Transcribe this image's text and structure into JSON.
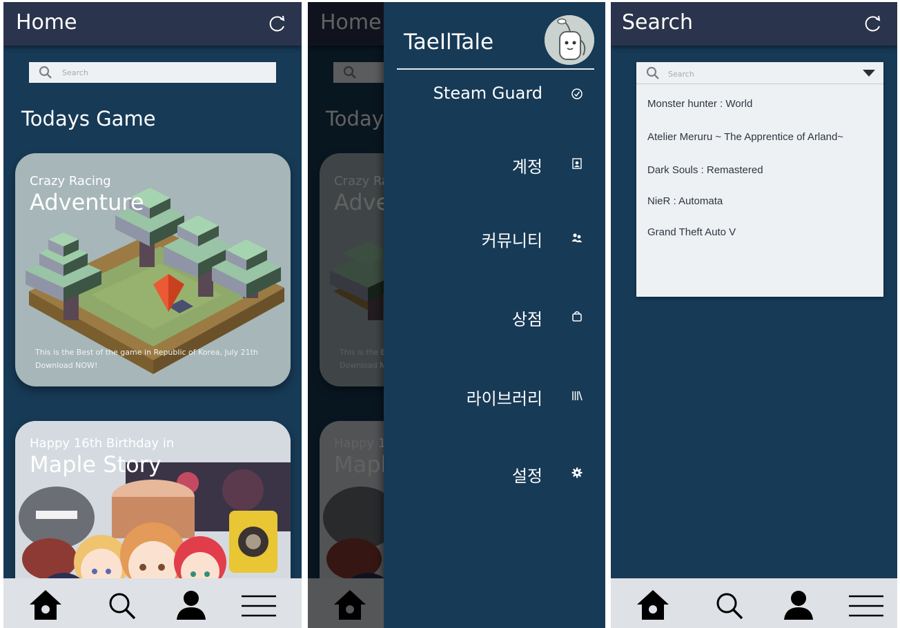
{
  "home": {
    "title": "Home",
    "search_placeholder": "Search",
    "section_title": "Todays Game",
    "card1": {
      "subtitle": "Crazy Racing",
      "title": "Adventure",
      "desc_line1": "This is the Best of the game in Republic of Korea, July 21th",
      "desc_line2": "Download NOW!"
    },
    "card2": {
      "subtitle": "Happy 16th Birthday in",
      "title": "Maple Story"
    }
  },
  "drawer": {
    "brand": "TaeIlTale",
    "items": [
      {
        "label": "Steam Guard",
        "icon": "check-circle-icon"
      },
      {
        "label": "계정",
        "icon": "account-card-icon"
      },
      {
        "label": "커뮤니티",
        "icon": "people-icon"
      },
      {
        "label": "상점",
        "icon": "shopping-bag-icon"
      },
      {
        "label": "라이브러리",
        "icon": "library-icon"
      },
      {
        "label": "설정",
        "icon": "gear-icon"
      }
    ]
  },
  "search_screen": {
    "title": "Search",
    "search_placeholder": "Search",
    "results": [
      "Monster hunter : World",
      "Atelier Meruru ~ The Apprentice of Arland~",
      "Dark Souls : Remastered",
      "NieR : Automata",
      "Grand Theft Auto V"
    ]
  },
  "bottom_nav": [
    "home-icon",
    "search-icon",
    "profile-icon",
    "menu-icon"
  ],
  "colors": {
    "background": "#173a56",
    "topbar": "#2a344c",
    "bottombar": "#dee1e5",
    "search_field": "#eef1f4"
  }
}
